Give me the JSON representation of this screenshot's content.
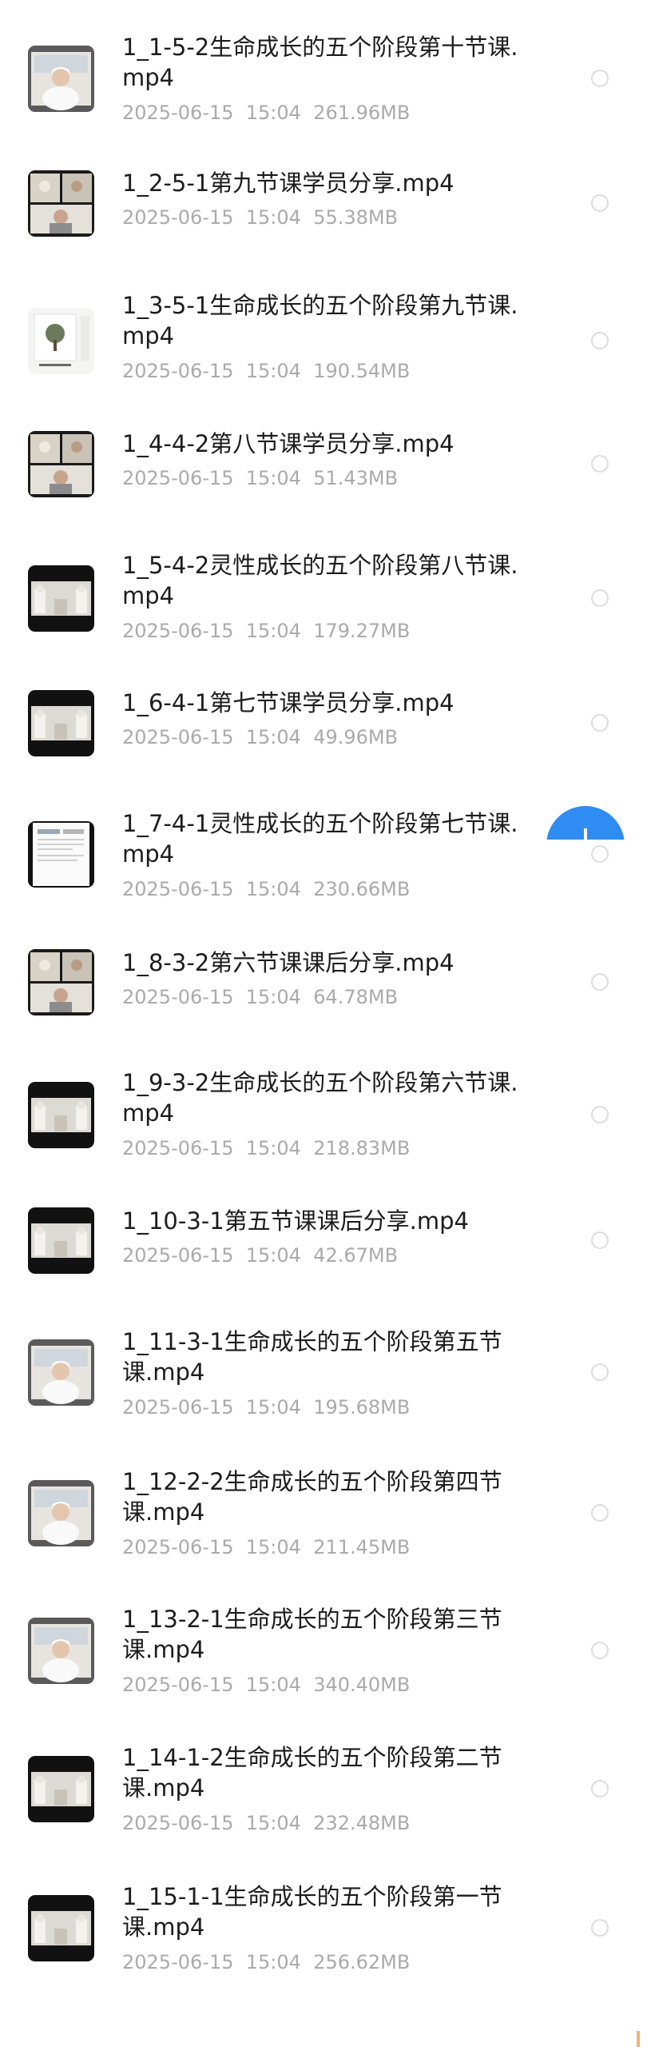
{
  "files": [
    {
      "name": "1_1-5-2生命成长的五个阶段第十节课.mp4",
      "date": "2025-06-15",
      "time": "15:04",
      "size": "261.96MB",
      "thumbnail": "video-thumbnail-speaker"
    },
    {
      "name": "1_2-5-1第九节课学员分享.mp4",
      "date": "2025-06-15",
      "time": "15:04",
      "size": "55.38MB",
      "thumbnail": "video-thumbnail-video-call"
    },
    {
      "name": "1_3-5-1生命成长的五个阶段第九节课.mp4",
      "date": "2025-06-15",
      "time": "15:04",
      "size": "190.54MB",
      "thumbnail": "video-thumbnail-slide"
    },
    {
      "name": "1_4-4-2第八节课学员分享.mp4",
      "date": "2025-06-15",
      "time": "15:04",
      "size": "51.43MB",
      "thumbnail": "video-thumbnail-video-call"
    },
    {
      "name": "1_5-4-2灵性成长的五个阶段第八节课.mp4",
      "date": "2025-06-15",
      "time": "15:04",
      "size": "179.27MB",
      "thumbnail": "video-thumbnail-dark"
    },
    {
      "name": "1_6-4-1第七节课学员分享.mp4",
      "date": "2025-06-15",
      "time": "15:04",
      "size": "49.96MB",
      "thumbnail": "video-thumbnail-dark"
    },
    {
      "name": "1_7-4-1灵性成长的五个阶段第七节课.mp4",
      "date": "2025-06-15",
      "time": "15:04",
      "size": "230.66MB",
      "thumbnail": "video-thumbnail-document"
    },
    {
      "name": "1_8-3-2第六节课课后分享.mp4",
      "date": "2025-06-15",
      "time": "15:04",
      "size": "64.78MB",
      "thumbnail": "video-thumbnail-video-call"
    },
    {
      "name": "1_9-3-2生命成长的五个阶段第六节课.mp4",
      "date": "2025-06-15",
      "time": "15:04",
      "size": "218.83MB",
      "thumbnail": "video-thumbnail-dark"
    },
    {
      "name": "1_10-3-1第五节课课后分享.mp4",
      "date": "2025-06-15",
      "time": "15:04",
      "size": "42.67MB",
      "thumbnail": "video-thumbnail-dark"
    },
    {
      "name": "1_11-3-1生命成长的五个阶段第五节课.mp4",
      "date": "2025-06-15",
      "time": "15:04",
      "size": "195.68MB",
      "thumbnail": "video-thumbnail-speaker"
    },
    {
      "name": "1_12-2-2生命成长的五个阶段第四节课.mp4",
      "date": "2025-06-15",
      "time": "15:04",
      "size": "211.45MB",
      "thumbnail": "video-thumbnail-speaker"
    },
    {
      "name": "1_13-2-1生命成长的五个阶段第三节课.mp4",
      "date": "2025-06-15",
      "time": "15:04",
      "size": "340.40MB",
      "thumbnail": "video-thumbnail-speaker"
    },
    {
      "name": "1_14-1-2生命成长的五个阶段第二节课.mp4",
      "date": "2025-06-15",
      "time": "15:04",
      "size": "232.48MB",
      "thumbnail": "video-thumbnail-dark"
    },
    {
      "name": "1_15-1-1生命成长的五个阶段第一节课.mp4",
      "date": "2025-06-15",
      "time": "15:04",
      "size": "256.62MB",
      "thumbnail": "video-thumbnail-dark"
    }
  ],
  "fab": {
    "icon": "plus-icon",
    "color": "#2f8cf2"
  },
  "colors": {
    "title": "#1c1c1c",
    "meta": "#aaaaaa",
    "radio": "#dcdcdc"
  }
}
